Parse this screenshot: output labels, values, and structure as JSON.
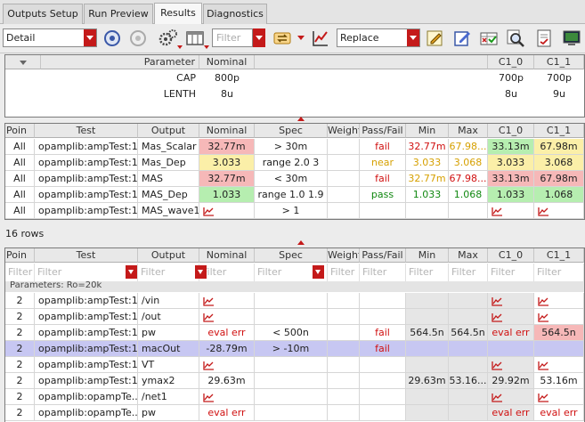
{
  "tabs": [
    "Outputs Setup",
    "Run Preview",
    "Results",
    "Diagnostics"
  ],
  "toolbar": {
    "view_select": "Detail",
    "filter_placeholder": "Filter",
    "mode_select": "Replace"
  },
  "params_table": {
    "columns": [
      "Parameter",
      "Nominal",
      "C1_0",
      "C1_1"
    ],
    "rows": [
      {
        "param": "CAP",
        "nominal": "800p",
        "c1_0": "700p",
        "c1_1": "700p"
      },
      {
        "param": "LENTH",
        "nominal": "8u",
        "c1_0": "8u",
        "c1_1": "9u"
      }
    ]
  },
  "results_table": {
    "columns": [
      "Poin",
      "Test",
      "Output",
      "Nominal",
      "Spec",
      "Weight",
      "Pass/Fail",
      "Min",
      "Max",
      "C1_0",
      "C1_1"
    ],
    "rows": [
      {
        "point": "All",
        "test": "opamplib:ampTest:1",
        "output": "Mas_Scalar",
        "nominal": "32.77m",
        "spec": "> 30m",
        "weight": "",
        "passfail": "fail",
        "min": "32.77m",
        "max": "67.98...",
        "c1_0": "33.13m",
        "c1_1": "67.98m"
      },
      {
        "point": "All",
        "test": "opamplib:ampTest:1",
        "output": "Mas_Dep",
        "nominal": "3.033",
        "spec": "range 2.0 3",
        "weight": "",
        "passfail": "near",
        "min": "3.033",
        "max": "3.068",
        "c1_0": "3.033",
        "c1_1": "3.068"
      },
      {
        "point": "All",
        "test": "opamplib:ampTest:1",
        "output": "MAS",
        "nominal": "32.77m",
        "spec": "< 30m",
        "weight": "",
        "passfail": "fail",
        "min": "32.77m",
        "max": "67.98...",
        "c1_0": "33.13m",
        "c1_1": "67.98m"
      },
      {
        "point": "All",
        "test": "opamplib:ampTest:1",
        "output": "MAS_Dep",
        "nominal": "1.033",
        "spec": "range 1.0 1.9",
        "weight": "",
        "passfail": "pass",
        "min": "1.033",
        "max": "1.068",
        "c1_0": "1.033",
        "c1_1": "1.068"
      },
      {
        "point": "All",
        "test": "opamplib:ampTest:1",
        "output": "MAS_wave1",
        "nominal": "",
        "spec": "> 1",
        "weight": "",
        "passfail": "",
        "min": "",
        "max": "",
        "c1_0": "",
        "c1_1": ""
      }
    ]
  },
  "row_count": "16 rows",
  "detail_table": {
    "columns": [
      "Poin",
      "Test",
      "Output",
      "Nominal",
      "Spec",
      "Weight",
      "Pass/Fail",
      "Min",
      "Max",
      "C1_0",
      "C1_1"
    ],
    "filter_text": "Filter",
    "group_label": "Parameters: Ro=20k",
    "rows": [
      {
        "point": "2",
        "test": "opamplib:ampTest:1",
        "output": "/vin",
        "nominal": "",
        "spec": "",
        "passfail": "",
        "min": "",
        "max": "",
        "c1_0": "",
        "c1_1": ""
      },
      {
        "point": "2",
        "test": "opamplib:ampTest:1",
        "output": "/out",
        "nominal": "",
        "spec": "",
        "passfail": "",
        "min": "",
        "max": "",
        "c1_0": "",
        "c1_1": ""
      },
      {
        "point": "2",
        "test": "opamplib:ampTest:1",
        "output": "pw",
        "nominal": "eval err",
        "spec": "< 500n",
        "passfail": "fail",
        "min": "564.5n",
        "max": "564.5n",
        "c1_0": "eval err",
        "c1_1": "564.5n"
      },
      {
        "point": "2",
        "test": "opamplib:ampTest:1",
        "output": "macOut",
        "nominal": "-28.79m",
        "spec": "> -10m",
        "passfail": "fail",
        "min": "",
        "max": "",
        "c1_0": "",
        "c1_1": ""
      },
      {
        "point": "2",
        "test": "opamplib:ampTest:1",
        "output": "VT",
        "nominal": "",
        "spec": "",
        "passfail": "",
        "min": "",
        "max": "",
        "c1_0": "",
        "c1_1": ""
      },
      {
        "point": "2",
        "test": "opamplib:ampTest:1",
        "output": "ymax2",
        "nominal": "29.63m",
        "spec": "",
        "passfail": "",
        "min": "29.63m",
        "max": "53.16...",
        "c1_0": "29.92m",
        "c1_1": "53.16m"
      },
      {
        "point": "2",
        "test": "opamplib:opampTe...",
        "output": "/net1",
        "nominal": "",
        "spec": "",
        "passfail": "",
        "min": "",
        "max": "",
        "c1_0": "",
        "c1_1": ""
      },
      {
        "point": "2",
        "test": "opamplib:opampTe...",
        "output": "pw",
        "nominal": "eval err",
        "spec": "",
        "passfail": "",
        "min": "",
        "max": "",
        "c1_0": "eval err",
        "c1_1": "eval err"
      }
    ]
  },
  "colors": {
    "fail_bg": "#f6b8b8",
    "near_bg": "#fbefa8",
    "pass_bg": "#b6eeb0",
    "fail_text": "#d01010",
    "near_text": "#d6a000",
    "pass_text": "#118811",
    "selected_row": "#c7c7f2",
    "accent_red": "#c41a1a"
  }
}
